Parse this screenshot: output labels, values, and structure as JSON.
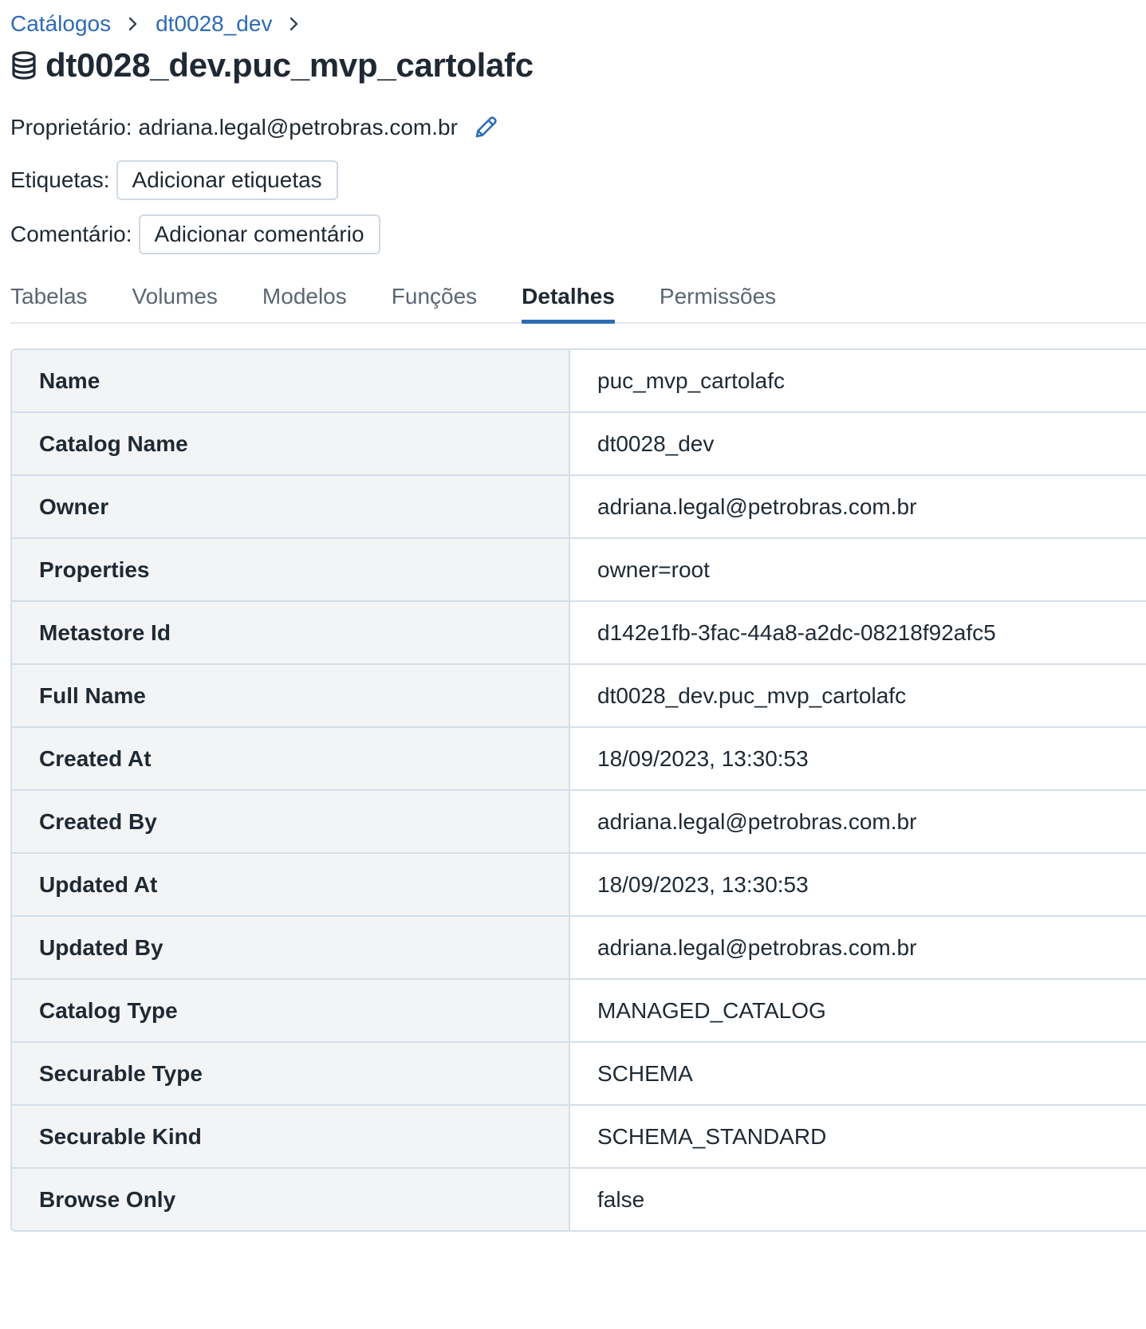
{
  "breadcrumb": {
    "items": [
      "Catálogos",
      "dt0028_dev"
    ]
  },
  "header": {
    "title": "dt0028_dev.puc_mvp_cartolafc",
    "icon": "database-icon"
  },
  "owner": {
    "label": "Proprietário:",
    "value": "adriana.legal@petrobras.com.br"
  },
  "tags": {
    "label": "Etiquetas:",
    "button": "Adicionar etiquetas"
  },
  "comment": {
    "label": "Comentário:",
    "button": "Adicionar comentário"
  },
  "tabs": [
    {
      "label": "Tabelas",
      "active": false
    },
    {
      "label": "Volumes",
      "active": false
    },
    {
      "label": "Modelos",
      "active": false
    },
    {
      "label": "Funções",
      "active": false
    },
    {
      "label": "Detalhes",
      "active": true
    },
    {
      "label": "Permissões",
      "active": false
    }
  ],
  "details": [
    {
      "key": "Name",
      "value": "puc_mvp_cartolafc"
    },
    {
      "key": "Catalog Name",
      "value": "dt0028_dev"
    },
    {
      "key": "Owner",
      "value": "adriana.legal@petrobras.com.br"
    },
    {
      "key": "Properties",
      "value": "owner=root"
    },
    {
      "key": "Metastore Id",
      "value": "d142e1fb-3fac-44a8-a2dc-08218f92afc5"
    },
    {
      "key": "Full Name",
      "value": "dt0028_dev.puc_mvp_cartolafc"
    },
    {
      "key": "Created At",
      "value": "18/09/2023, 13:30:53"
    },
    {
      "key": "Created By",
      "value": "adriana.legal@petrobras.com.br"
    },
    {
      "key": "Updated At",
      "value": "18/09/2023, 13:30:53"
    },
    {
      "key": "Updated By",
      "value": "adriana.legal@petrobras.com.br"
    },
    {
      "key": "Catalog Type",
      "value": "MANAGED_CATALOG"
    },
    {
      "key": "Securable Type",
      "value": "SCHEMA"
    },
    {
      "key": "Securable Kind",
      "value": "SCHEMA_STANDARD"
    },
    {
      "key": "Browse Only",
      "value": "false"
    }
  ],
  "colors": {
    "link": "#2e6bb5",
    "tab_indicator": "#2e6bb5",
    "key_bg": "#f3f4f6",
    "border": "#d5dee8"
  }
}
